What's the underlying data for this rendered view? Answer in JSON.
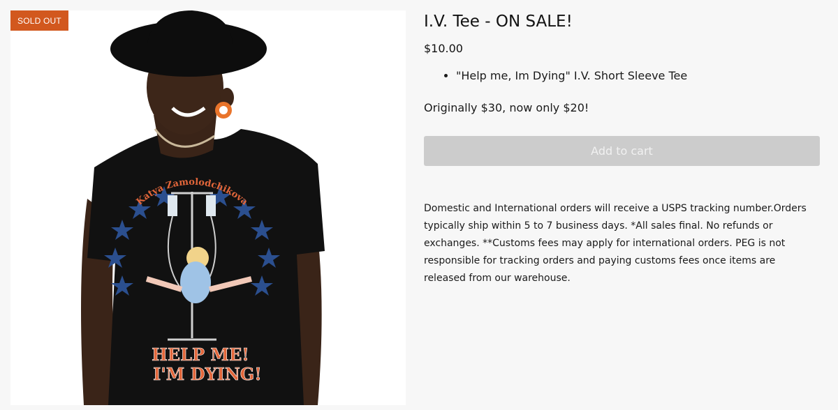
{
  "product": {
    "badge": "SOLD OUT",
    "title": "I.V. Tee - ON SALE!",
    "price": "$10.00",
    "features": [
      "\"Help me, Im Dying\" I.V. Short Sleeve Tee"
    ],
    "note": "Originally $30, now only $20!",
    "add_to_cart_label": "Add to cart",
    "shipping_info": "Domestic and International orders will receive a USPS tracking number.Orders typically ship within 5 to 7 business days. *All sales final. No refunds or exchanges. **Customs fees may apply for international orders. PEG is not responsible for tracking orders and paying customs fees once items are released from our warehouse."
  },
  "shirt_print": {
    "arc_text": "Katya Zamolodchikova",
    "line1": "HELP ME!",
    "line2": "I'M DYING!"
  },
  "colors": {
    "badge": "#d2581e",
    "button_disabled": "#cccccc",
    "background": "#f7f7f7"
  }
}
